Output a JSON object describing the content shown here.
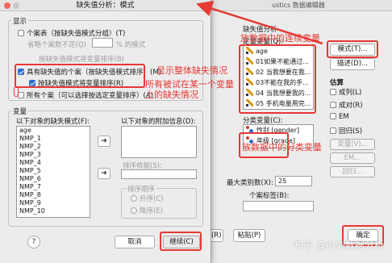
{
  "main_dialog": {
    "title": "ustics 数据编辑器",
    "variables_section_title": "缺失值分析",
    "quantitative_label": "定量变量(Q):",
    "quantitative_items": [
      "age",
      "01如果不能通过...",
      "02 当我想要在我...",
      "03不能在我的手...",
      "04 当我想要我的...",
      "05 手机电量用完..."
    ],
    "categorical_label": "分类变量(C):",
    "categorical_items": [
      "性别 [gender]",
      "年级 [grade]"
    ],
    "max_categories_label": "最大类别数(X):",
    "max_categories_value": "25",
    "case_label_label": "个案标签(B):",
    "buttons": {
      "patterns": "模式(T)...",
      "descriptives": "描述(D)...",
      "ok": "确定",
      "paste": "粘贴(P)",
      "reset": "置(R)"
    },
    "estimation_title": "估算",
    "estimation_items": [
      "成列(L)",
      "成对(R)",
      "EM",
      "回归(S)"
    ],
    "estimation_buttons": [
      "变量(V)...",
      "EM...",
      "回归..."
    ]
  },
  "patterns_dialog": {
    "title": "缺失值分析：模式",
    "display_title": "显示",
    "opt_tabulated": "个案表（按缺失值模式分组）(T)",
    "opt_omit_label": "省略个案数不足(Q)",
    "opt_omit_unit": "% 的模式",
    "opt_sort_disabled": "按缺失值模式将变量排序(B)",
    "opt_missing_cases": "具有缺失值的个案（按缺失值模式排序）(M)",
    "opt_sort_vars": "按缺失值模式将变量排序(R)",
    "opt_all_cases": "所有个案（可以选择按选定变量排序）(A)",
    "variables_title": "变量",
    "missing_list_label": "以下对象的缺失模式(F):",
    "missing_list_items": [
      "age",
      "NMP_1",
      "NMP_2",
      "NMP_3",
      "NMP_4",
      "NMP_5",
      "NMP_6",
      "NMP_7",
      "NMP_8",
      "NMP_9",
      "NMP_10"
    ],
    "additional_label": "以下对象的附加信息(D):",
    "sort_by_label": "排序依据(S):",
    "sort_order_title": "排序顺序",
    "sort_ascending": "升序(C)",
    "sort_descending": "降序(E)",
    "help_button": "?",
    "cancel_button": "取消",
    "continue_button": "继续(C)"
  },
  "annotations": {
    "continuous_vars": "放数据中的连续变量",
    "show_overall": "显示整体缺失情况",
    "all_cases_line1": "所有被试在某一个变量",
    "all_cases_line2": "上的缺失情况",
    "categorical_vars": "放数据中的分类变量",
    "watermark": "知乎 @小刘数据分析"
  },
  "colors": {
    "annotation_red": "#e53935",
    "checkbox_blue": "#2c6bd1"
  }
}
